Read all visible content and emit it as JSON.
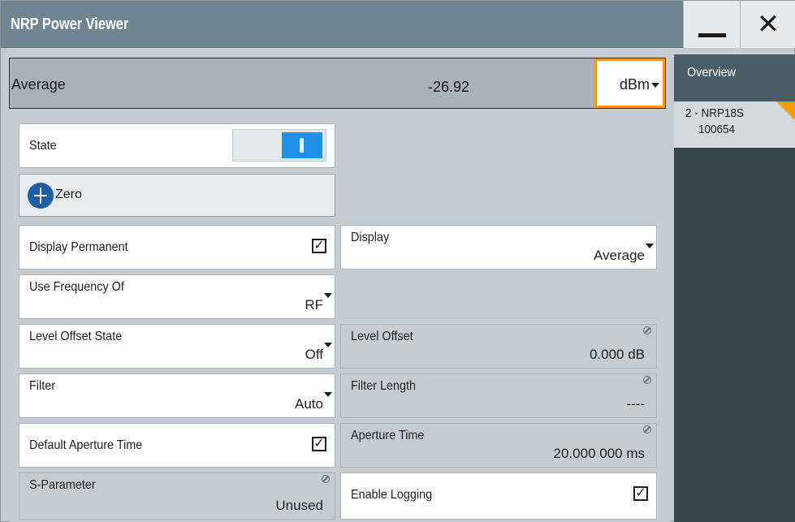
{
  "window": {
    "title": "NRP Power Viewer",
    "minimize_icon": "minimize-icon",
    "close_glyph": "✕"
  },
  "average": {
    "label": "Average",
    "value": "-26.92",
    "unit": "dBm"
  },
  "state": {
    "label": "State",
    "on": true
  },
  "zero": {
    "label": "Zero",
    "icon": "zero-crosshair-icon"
  },
  "display_permanent": {
    "label": "Display Permanent",
    "checked": true
  },
  "display": {
    "label": "Display",
    "value": "Average"
  },
  "use_frequency_of": {
    "label": "Use Frequency Of",
    "value": "RF"
  },
  "level_offset_state": {
    "label": "Level Offset State",
    "value": "Off"
  },
  "level_offset": {
    "label": "Level Offset",
    "value": "0.000 dB"
  },
  "filter": {
    "label": "Filter",
    "value": "Auto"
  },
  "filter_length": {
    "label": "Filter Length",
    "value": "----"
  },
  "default_aperture_time": {
    "label": "Default Aperture Time",
    "checked": true
  },
  "aperture_time": {
    "label": "Aperture Time",
    "value": "20.000 000 ms"
  },
  "s_parameter": {
    "label": "S-Parameter",
    "value": "Unused"
  },
  "enable_logging": {
    "label": "Enable Logging",
    "checked": true
  },
  "sidebar": {
    "overview_label": "Overview",
    "device_line1": "2 - NRP18S",
    "device_line2": "100654"
  },
  "colors": {
    "accent": "#f39c12",
    "toggle_on": "#1e90e6",
    "titlebar": "#6f8592",
    "sidebar": "#37474f"
  },
  "checkmark": "✓"
}
